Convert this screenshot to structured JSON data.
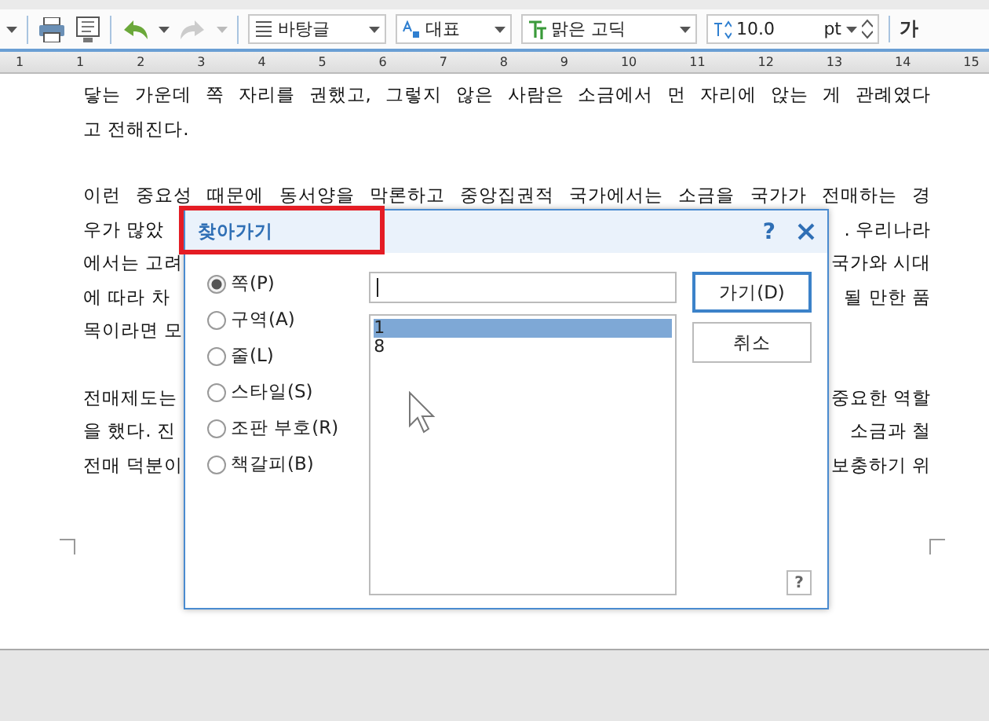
{
  "toolbar": {
    "style": "바탕글",
    "style_set": "대표",
    "font": "맑은 고딕",
    "size": "10.0",
    "unit": "pt",
    "bold_glyph": "가"
  },
  "ruler": {
    "labels": [
      "1",
      "1",
      "2",
      "3",
      "4",
      "5",
      "6",
      "7",
      "8",
      "9",
      "10",
      "11",
      "12",
      "13",
      "14",
      "15"
    ]
  },
  "document": {
    "paragraphs": [
      [
        {
          "kind": "full",
          "text": "닿는 가운데 쪽 자리를 권했고, 그렇지 않은 사람은 소금에서 먼 자리에 앉는 게 관례였다"
        },
        {
          "kind": "last",
          "text": "고 전해진다."
        }
      ],
      [
        {
          "kind": "full",
          "text": "이런 중요성 때문에 동서양을 막론하고 중앙집권적 국가에서는 소금을 국가가 전매하는 경"
        },
        {
          "kind": "split",
          "left": "우가 많았",
          "right": ". 우리나라"
        },
        {
          "kind": "split",
          "left": "에서는 고려",
          "right": "국가와 시대"
        },
        {
          "kind": "split",
          "left": "에 따라 차",
          "right": "될 만한 품"
        },
        {
          "kind": "last",
          "text": "목이라면 모"
        }
      ],
      [
        {
          "kind": "split",
          "left": "전매제도는",
          "right": "중요한 역할"
        },
        {
          "kind": "split",
          "left": "을 했다. 진",
          "right": "소금과 철"
        },
        {
          "kind": "split",
          "left": "전매 덕분이",
          "right": "보충하기 위"
        }
      ]
    ]
  },
  "dialog": {
    "title": "찾아가기",
    "help_glyph": "?",
    "highlighted": true,
    "options": [
      {
        "label": "쪽(P)",
        "selected": true
      },
      {
        "label": "구역(A)",
        "selected": false
      },
      {
        "label": "줄(L)",
        "selected": false
      },
      {
        "label": "스타일(S)",
        "selected": false
      },
      {
        "label": "조판 부호(R)",
        "selected": false
      },
      {
        "label": "책갈피(B)",
        "selected": false
      }
    ],
    "list": [
      {
        "label": "1",
        "selected": true
      },
      {
        "label": "8",
        "selected": false
      }
    ],
    "buttons": [
      {
        "label": "가기(D)",
        "default": true
      },
      {
        "label": "취소",
        "default": false
      }
    ],
    "corner_help": "?"
  }
}
